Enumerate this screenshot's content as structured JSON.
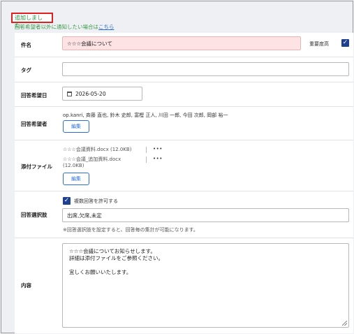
{
  "status": {
    "message": "追加しました。",
    "notify_prefix": "回答希望者以外に通知したい場合は",
    "notify_link": "こちら"
  },
  "subject": {
    "label": "件名",
    "value": "☆☆☆会議について",
    "priority_label": "重要度高",
    "priority_checked": true
  },
  "tag": {
    "label": "タグ",
    "value": ""
  },
  "due_date": {
    "label": "回答希望日",
    "value": "2026-05-20",
    "icon": "calendar-icon"
  },
  "respondents": {
    "label": "回答希望者",
    "names": "op.kanri, 斉藤 直也, 鈴木 史郎, 富樫 正人, 川田 一郎, 今田 次郎, 岡部 裕一",
    "edit_label": "編集"
  },
  "attachments": {
    "label": "添付ファイル",
    "files": [
      {
        "name": "☆☆☆会議資料.docx (12.0KB)",
        "menu": "•••"
      },
      {
        "name": "☆☆☆会議_追加資料.docx",
        "size": "(12.0KB)",
        "menu": "•••"
      }
    ],
    "edit_label": "編集"
  },
  "choices": {
    "label": "回答選択肢",
    "multi_label": "複数回答を許可する",
    "multi_checked": true,
    "value": "出席,欠席,未定",
    "hint": "※回答選択肢を設定すると、回答毎の集計が可能になります。"
  },
  "content": {
    "label": "内容",
    "lines": [
      "☆☆☆会議についてお知らせします。",
      "詳細は添付ファイルをご参照ください。",
      "",
      "宜しくお願いいたします。"
    ]
  },
  "colors": {
    "accent": "#2a6fd6",
    "checkbox": "#1f3f8f",
    "success": "#23943c",
    "error_border": "#e02020",
    "required_bg": "#fde3e3"
  }
}
